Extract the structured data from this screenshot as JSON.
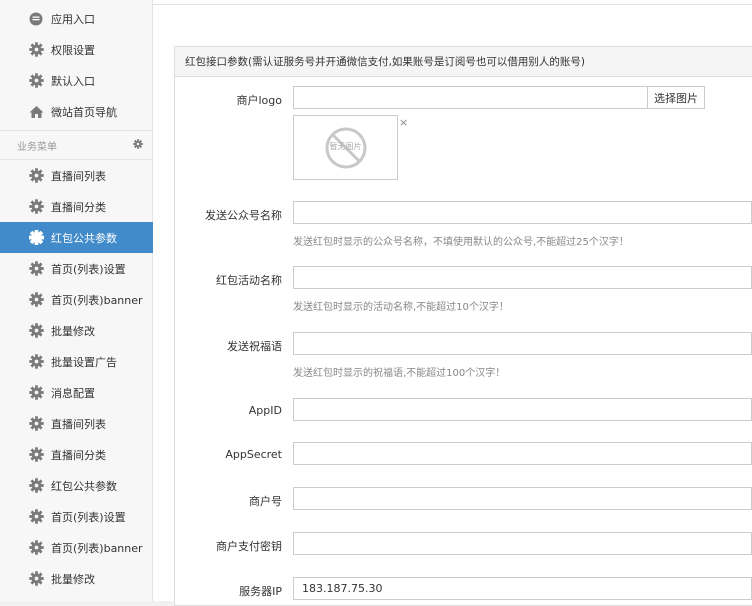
{
  "sidebar": {
    "top_items": [
      {
        "label": "应用入口",
        "icon": "chat-bubble-icon"
      },
      {
        "label": "权限设置",
        "icon": "gear-icon"
      },
      {
        "label": "默认入口",
        "icon": "gear-icon"
      },
      {
        "label": "微站首页导航",
        "icon": "home-icon"
      }
    ],
    "section_title": "业务菜单",
    "items": [
      {
        "label": "直播间列表",
        "icon": "gear-icon"
      },
      {
        "label": "直播间分类",
        "icon": "gear-icon"
      },
      {
        "label": "红包公共参数",
        "icon": "gear-icon",
        "active": true
      },
      {
        "label": "首页(列表)设置",
        "icon": "gear-icon"
      },
      {
        "label": "首页(列表)banner",
        "icon": "gear-icon"
      },
      {
        "label": "批量修改",
        "icon": "gear-icon"
      },
      {
        "label": "批量设置广告",
        "icon": "gear-icon"
      },
      {
        "label": "消息配置",
        "icon": "gear-icon"
      },
      {
        "label": "直播间列表",
        "icon": "gear-icon"
      },
      {
        "label": "直播间分类",
        "icon": "gear-icon"
      },
      {
        "label": "红包公共参数",
        "icon": "gear-icon"
      },
      {
        "label": "首页(列表)设置",
        "icon": "gear-icon"
      },
      {
        "label": "首页(列表)banner",
        "icon": "gear-icon"
      },
      {
        "label": "批量修改",
        "icon": "gear-icon"
      }
    ]
  },
  "panel": {
    "title": "红包接口参数(需认证服务号并开通微信支付,如果账号是订阅号也可以借用别人的账号)"
  },
  "form": {
    "logo_label": "商户logo",
    "logo_value": "",
    "select_image_label": "选择图片",
    "no_image_text": "暂无图片",
    "close_glyph": "×",
    "sender_label": "发送公众号名称",
    "sender_hint": "发送红包时显示的公众号名称，不填使用默认的公众号,不能超过25个汉字！",
    "activity_label": "红包活动名称",
    "activity_hint": "发送红包时显示的活动名称,不能超过10个汉字！",
    "wishing_label": "发送祝福语",
    "wishing_hint": "发送红包时显示的祝福语,不能超过100个汉字！",
    "appid_label": "AppID",
    "appsecret_label": "AppSecret",
    "mchid_label": "商户号",
    "paykey_label": "商户支付密钥",
    "serverip_label": "服务器IP",
    "serverip_value": "183.187.75.30"
  },
  "colors": {
    "active": "#428bca",
    "sidebar_bg": "#f7f7f7",
    "icon": "#7a7a7a"
  }
}
